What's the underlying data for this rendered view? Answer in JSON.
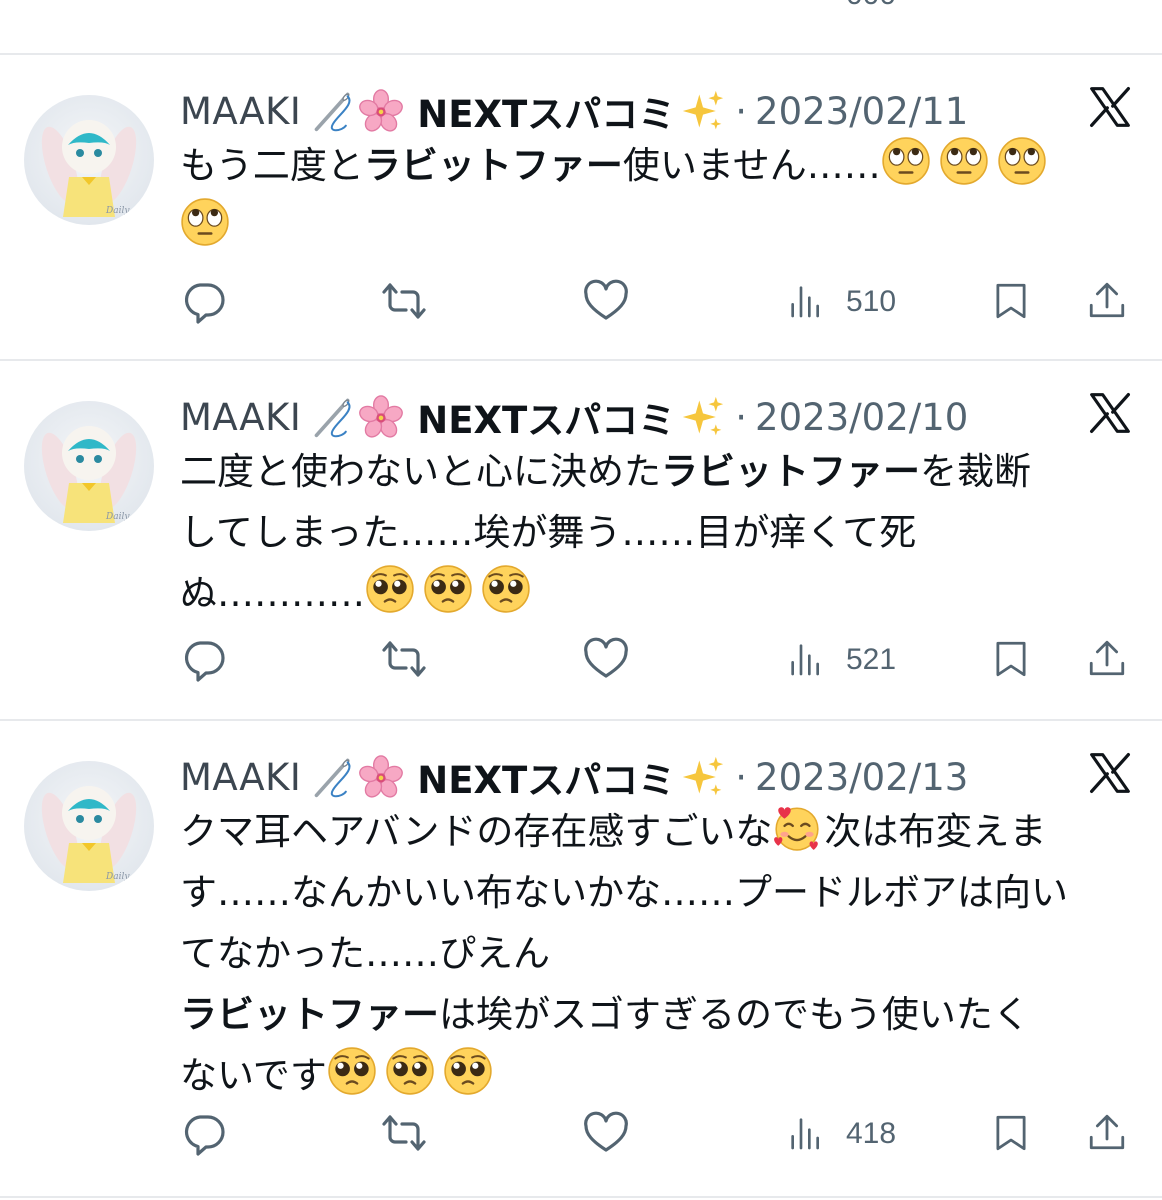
{
  "top_partial_row": {
    "views_count_partial": "000"
  },
  "tweets": [
    {
      "handle": "MAAKI",
      "display_name": "NEXTスパコミ",
      "dot": "·",
      "date": "2023/02/11",
      "body": {
        "line1_pre": "もう二度と",
        "line1_bold": "ラビットファー",
        "line1_post": "使いません……",
        "emoji_names": [
          "face-with-rolling-eyes",
          "face-with-rolling-eyes",
          "face-with-rolling-eyes",
          "face-with-rolling-eyes"
        ]
      },
      "views": "510"
    },
    {
      "handle": "MAAKI",
      "display_name": "NEXTスパコミ",
      "dot": "·",
      "date": "2023/02/10",
      "body": {
        "line1_pre": "二度と使わないと心に決めた",
        "line1_bold": "ラビットファー",
        "line1_post": "を裁断",
        "line2": "してしまった……埃が舞う……目が痒くて死",
        "line3": "ぬ…………",
        "emoji_names": [
          "pleading-face",
          "pleading-face",
          "pleading-face"
        ]
      },
      "views": "521"
    },
    {
      "handle": "MAAKI",
      "display_name": "NEXTスパコミ",
      "dot": "·",
      "date": "2023/02/13",
      "body": {
        "line1_pre": "クマ耳ヘアバンドの存在感すごいな",
        "line1_post": "次は布変えま",
        "line2": "す……なんかいい布ないかな……プードルボアは向い",
        "line3": "てなかった……ぴえん",
        "line4_bold": "ラビットファー",
        "line4_post": "は埃がスゴすぎるのでもう使いたく",
        "line5": "ないです",
        "emoji_names": [
          "smiling-face-with-hearts",
          "pleading-face",
          "pleading-face",
          "pleading-face"
        ]
      },
      "views": "418"
    }
  ],
  "colors": {
    "text_primary": "#0f1419",
    "text_secondary": "#536471",
    "divider": "#e7e9ec",
    "background": "#ffffff"
  },
  "icons": [
    "reply-icon",
    "retweet-icon",
    "like-icon",
    "views-icon",
    "bookmark-icon",
    "share-icon",
    "x-logo-icon",
    "sewing-needle-icon",
    "cherry-blossom-icon",
    "sparkles-icon"
  ]
}
